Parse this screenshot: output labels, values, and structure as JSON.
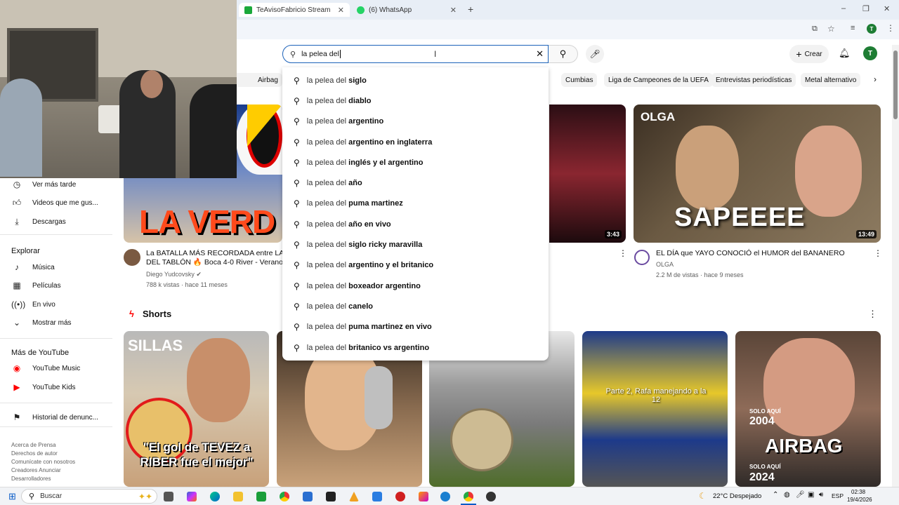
{
  "browser": {
    "tabs": [
      {
        "title": "TeAvisoFabricio Stream - Watch",
        "favicon_color": "#1aa83a"
      },
      {
        "title": "(6) WhatsApp",
        "favicon_color": "#25d366"
      }
    ],
    "new_tab": "+",
    "window_controls": [
      "–",
      "❐",
      "✕"
    ]
  },
  "youtube": {
    "search": {
      "value": "la pelea del "
    },
    "create_label": "Crear",
    "avatar_letter": "T",
    "chips": [
      "Airbag",
      "Cumbias",
      "Liga de Campeones de la UEFA",
      "Entrevistas periodísticas",
      "Metal alternativo"
    ],
    "suggestions": [
      {
        "q": "la pelea del",
        "r": " siglo"
      },
      {
        "q": "la pelea del",
        "r": " diablo"
      },
      {
        "q": "la pelea del",
        "r": " argentino"
      },
      {
        "q": "la pelea del",
        "r": " argentino en inglaterra"
      },
      {
        "q": "la pelea del",
        "r": " inglés y el argentino"
      },
      {
        "q": "la pelea del",
        "r": " año"
      },
      {
        "q": "la pelea del",
        "r": " puma martinez"
      },
      {
        "q": "la pelea del",
        "r": " año en vivo"
      },
      {
        "q": "la pelea del",
        "r": " siglo ricky maravilla"
      },
      {
        "q": "la pelea del",
        "r": " argentino y el britanico"
      },
      {
        "q": "la pelea del",
        "r": " boxeador argentino"
      },
      {
        "q": "la pelea del",
        "r": " canelo"
      },
      {
        "q": "la pelea del",
        "r": " puma martinez en vivo"
      },
      {
        "q": "la pelea del",
        "r": " britanico vs argentino"
      }
    ],
    "sidebar": {
      "you_items": [
        "Ver más tarde",
        "Videos que me gus...",
        "Descargas"
      ],
      "explore_title": "Explorar",
      "explore_items": [
        "Música",
        "Películas",
        "En vivo",
        "Mostrar más"
      ],
      "more_title": "Más de YouTube",
      "more_items": [
        "YouTube Music",
        "YouTube Kids"
      ],
      "report_history": "Historial de denunc...",
      "footer_lines": [
        "Acerca de  Prensa",
        "Derechos de autor",
        "Comunícate con nosotros",
        "Creadores  Anunciar",
        "Desarrolladores"
      ]
    },
    "videos": [
      {
        "thumb_text": "LA VERD",
        "title": "La BATALLA MÁS RECORDADA entre LA",
        "title2": "DEL TABLÓN 🔥 Boca 4-0 River - Verano",
        "channel": "Diego Yudcovsky",
        "meta": "788 k vistas · hace 11 meses"
      },
      {
        "duration": "3:43"
      },
      {
        "thumb_label": "OLGA",
        "thumb_text": "SAPEEEE",
        "duration": "13:49",
        "title": "EL DÍA que YAYO CONOCIÓ el HUMOR del BANANERO",
        "channel": "OLGA",
        "meta": "2.2 M de vistas · hace 9 meses"
      }
    ],
    "shorts_title": "Shorts",
    "shorts": [
      {
        "top_text": "SILLAS",
        "caption": "\"El gol de TEVEZ a RIBER fue el mejor\""
      },
      {
        "caption": ""
      },
      {
        "caption": ""
      },
      {
        "caption": "Parte 2, Rafa manejando a la 12"
      },
      {
        "caption": "AIRBAG",
        "label1": "SOLO AQUÍ",
        "year1": "2004",
        "label2": "SOLO AQUÍ",
        "year2": "2024"
      }
    ]
  },
  "taskbar": {
    "search_label": "Buscar",
    "weather": "22°C  Despejado",
    "lang": "ESP",
    "time": "02:38",
    "date": "19/4/2026"
  }
}
